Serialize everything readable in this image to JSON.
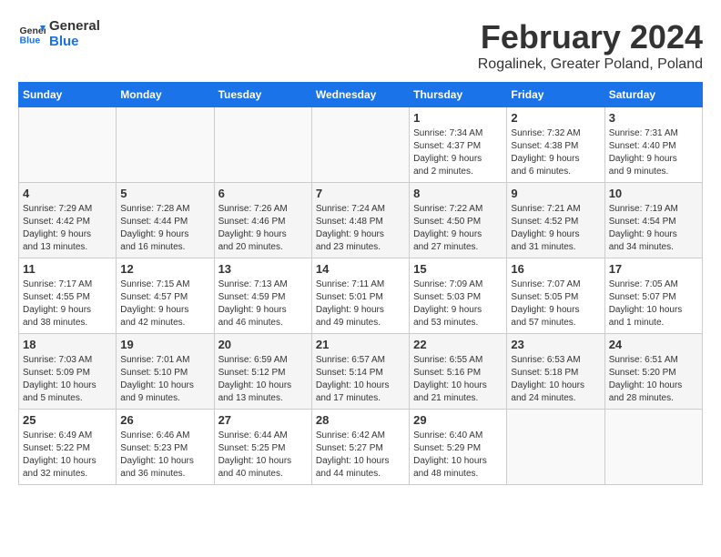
{
  "header": {
    "logo_line1": "General",
    "logo_line2": "Blue",
    "month": "February 2024",
    "location": "Rogalinek, Greater Poland, Poland"
  },
  "weekdays": [
    "Sunday",
    "Monday",
    "Tuesday",
    "Wednesday",
    "Thursday",
    "Friday",
    "Saturday"
  ],
  "weeks": [
    [
      {
        "day": "",
        "info": ""
      },
      {
        "day": "",
        "info": ""
      },
      {
        "day": "",
        "info": ""
      },
      {
        "day": "",
        "info": ""
      },
      {
        "day": "1",
        "info": "Sunrise: 7:34 AM\nSunset: 4:37 PM\nDaylight: 9 hours\nand 2 minutes."
      },
      {
        "day": "2",
        "info": "Sunrise: 7:32 AM\nSunset: 4:38 PM\nDaylight: 9 hours\nand 6 minutes."
      },
      {
        "day": "3",
        "info": "Sunrise: 7:31 AM\nSunset: 4:40 PM\nDaylight: 9 hours\nand 9 minutes."
      }
    ],
    [
      {
        "day": "4",
        "info": "Sunrise: 7:29 AM\nSunset: 4:42 PM\nDaylight: 9 hours\nand 13 minutes."
      },
      {
        "day": "5",
        "info": "Sunrise: 7:28 AM\nSunset: 4:44 PM\nDaylight: 9 hours\nand 16 minutes."
      },
      {
        "day": "6",
        "info": "Sunrise: 7:26 AM\nSunset: 4:46 PM\nDaylight: 9 hours\nand 20 minutes."
      },
      {
        "day": "7",
        "info": "Sunrise: 7:24 AM\nSunset: 4:48 PM\nDaylight: 9 hours\nand 23 minutes."
      },
      {
        "day": "8",
        "info": "Sunrise: 7:22 AM\nSunset: 4:50 PM\nDaylight: 9 hours\nand 27 minutes."
      },
      {
        "day": "9",
        "info": "Sunrise: 7:21 AM\nSunset: 4:52 PM\nDaylight: 9 hours\nand 31 minutes."
      },
      {
        "day": "10",
        "info": "Sunrise: 7:19 AM\nSunset: 4:54 PM\nDaylight: 9 hours\nand 34 minutes."
      }
    ],
    [
      {
        "day": "11",
        "info": "Sunrise: 7:17 AM\nSunset: 4:55 PM\nDaylight: 9 hours\nand 38 minutes."
      },
      {
        "day": "12",
        "info": "Sunrise: 7:15 AM\nSunset: 4:57 PM\nDaylight: 9 hours\nand 42 minutes."
      },
      {
        "day": "13",
        "info": "Sunrise: 7:13 AM\nSunset: 4:59 PM\nDaylight: 9 hours\nand 46 minutes."
      },
      {
        "day": "14",
        "info": "Sunrise: 7:11 AM\nSunset: 5:01 PM\nDaylight: 9 hours\nand 49 minutes."
      },
      {
        "day": "15",
        "info": "Sunrise: 7:09 AM\nSunset: 5:03 PM\nDaylight: 9 hours\nand 53 minutes."
      },
      {
        "day": "16",
        "info": "Sunrise: 7:07 AM\nSunset: 5:05 PM\nDaylight: 9 hours\nand 57 minutes."
      },
      {
        "day": "17",
        "info": "Sunrise: 7:05 AM\nSunset: 5:07 PM\nDaylight: 10 hours\nand 1 minute."
      }
    ],
    [
      {
        "day": "18",
        "info": "Sunrise: 7:03 AM\nSunset: 5:09 PM\nDaylight: 10 hours\nand 5 minutes."
      },
      {
        "day": "19",
        "info": "Sunrise: 7:01 AM\nSunset: 5:10 PM\nDaylight: 10 hours\nand 9 minutes."
      },
      {
        "day": "20",
        "info": "Sunrise: 6:59 AM\nSunset: 5:12 PM\nDaylight: 10 hours\nand 13 minutes."
      },
      {
        "day": "21",
        "info": "Sunrise: 6:57 AM\nSunset: 5:14 PM\nDaylight: 10 hours\nand 17 minutes."
      },
      {
        "day": "22",
        "info": "Sunrise: 6:55 AM\nSunset: 5:16 PM\nDaylight: 10 hours\nand 21 minutes."
      },
      {
        "day": "23",
        "info": "Sunrise: 6:53 AM\nSunset: 5:18 PM\nDaylight: 10 hours\nand 24 minutes."
      },
      {
        "day": "24",
        "info": "Sunrise: 6:51 AM\nSunset: 5:20 PM\nDaylight: 10 hours\nand 28 minutes."
      }
    ],
    [
      {
        "day": "25",
        "info": "Sunrise: 6:49 AM\nSunset: 5:22 PM\nDaylight: 10 hours\nand 32 minutes."
      },
      {
        "day": "26",
        "info": "Sunrise: 6:46 AM\nSunset: 5:23 PM\nDaylight: 10 hours\nand 36 minutes."
      },
      {
        "day": "27",
        "info": "Sunrise: 6:44 AM\nSunset: 5:25 PM\nDaylight: 10 hours\nand 40 minutes."
      },
      {
        "day": "28",
        "info": "Sunrise: 6:42 AM\nSunset: 5:27 PM\nDaylight: 10 hours\nand 44 minutes."
      },
      {
        "day": "29",
        "info": "Sunrise: 6:40 AM\nSunset: 5:29 PM\nDaylight: 10 hours\nand 48 minutes."
      },
      {
        "day": "",
        "info": ""
      },
      {
        "day": "",
        "info": ""
      }
    ]
  ]
}
